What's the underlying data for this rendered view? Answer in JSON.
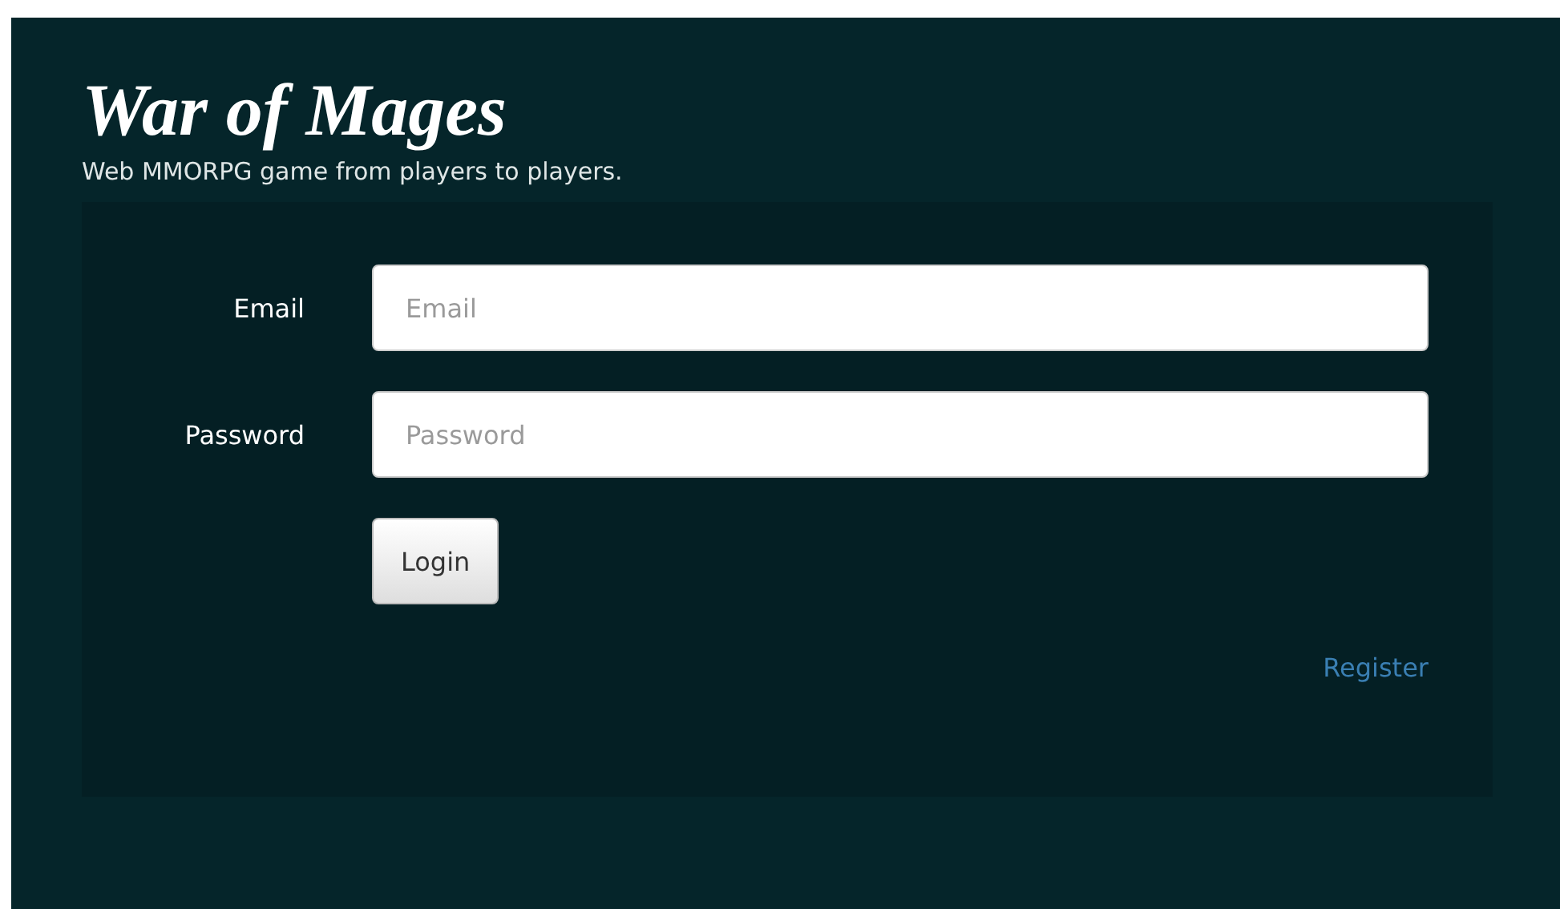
{
  "header": {
    "title": "War of Mages",
    "tagline": "Web MMORPG game from players to players."
  },
  "form": {
    "fields": [
      {
        "label": "Email",
        "placeholder": "Email"
      },
      {
        "label": "Password",
        "placeholder": "Password"
      }
    ],
    "submit": "Login",
    "register_link": "Register"
  }
}
